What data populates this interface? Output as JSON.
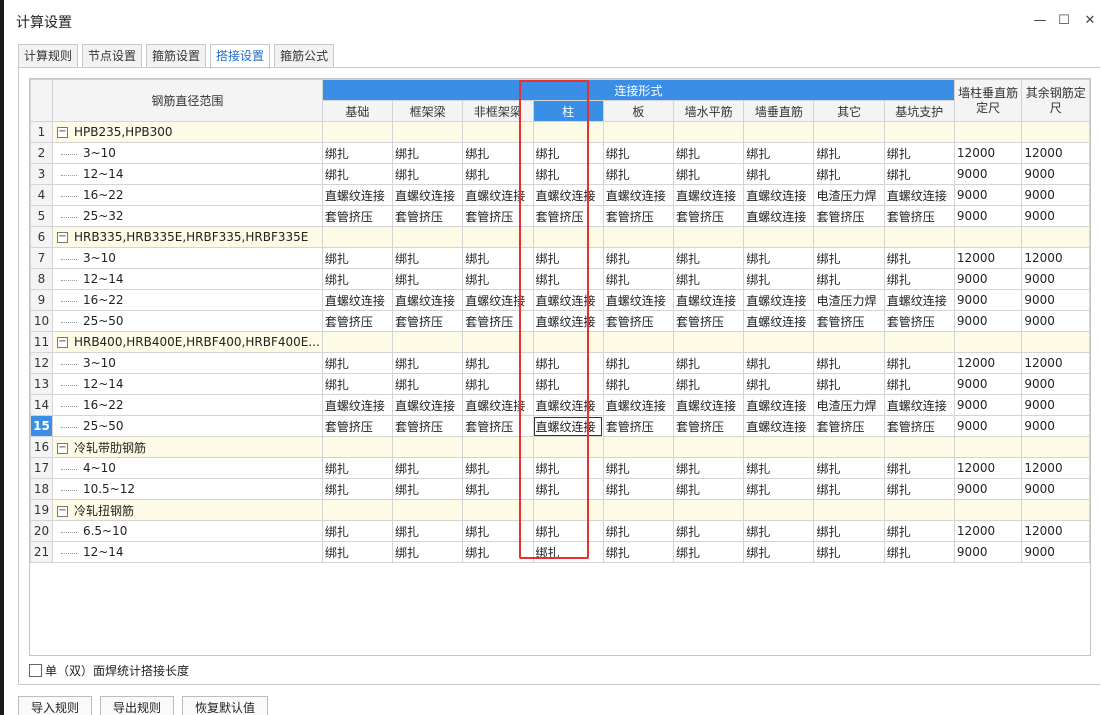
{
  "window": {
    "title": "计算设置",
    "min": "—",
    "max": "☐",
    "close": "✕"
  },
  "tabs": [
    "计算规则",
    "节点设置",
    "箍筋设置",
    "搭接设置",
    "箍筋公式"
  ],
  "table": {
    "range_header": "钢筋直径范围",
    "group_header": "连接形式",
    "sub_headers": [
      "基础",
      "框架梁",
      "非框架梁",
      "柱",
      "板",
      "墙水平筋",
      "墙垂直筋",
      "其它",
      "基坑支护"
    ],
    "col_wall_vertical": [
      "墙柱垂直筋",
      "定尺"
    ],
    "col_other": [
      "其余钢筋定",
      "尺"
    ],
    "groups": [
      {
        "row": "1",
        "name": "HPB235,HPB300",
        "rows": [
          {
            "row": "2",
            "range": "3~10",
            "values": [
              "绑扎",
              "绑扎",
              "绑扎",
              "绑扎",
              "绑扎",
              "绑扎",
              "绑扎",
              "绑扎",
              "绑扎",
              "12000",
              "12000"
            ]
          },
          {
            "row": "3",
            "range": "12~14",
            "values": [
              "绑扎",
              "绑扎",
              "绑扎",
              "绑扎",
              "绑扎",
              "绑扎",
              "绑扎",
              "绑扎",
              "绑扎",
              "9000",
              "9000"
            ]
          },
          {
            "row": "4",
            "range": "16~22",
            "values": [
              "直螺纹连接",
              "直螺纹连接",
              "直螺纹连接",
              "直螺纹连接",
              "直螺纹连接",
              "直螺纹连接",
              "直螺纹连接",
              "电渣压力焊",
              "直螺纹连接",
              "9000",
              "9000"
            ]
          },
          {
            "row": "5",
            "range": "25~32",
            "values": [
              "套管挤压",
              "套管挤压",
              "套管挤压",
              "套管挤压",
              "套管挤压",
              "套管挤压",
              "直螺纹连接",
              "套管挤压",
              "套管挤压",
              "9000",
              "9000"
            ]
          }
        ]
      },
      {
        "row": "6",
        "name": "HRB335,HRB335E,HRBF335,HRBF335E",
        "rows": [
          {
            "row": "7",
            "range": "3~10",
            "values": [
              "绑扎",
              "绑扎",
              "绑扎",
              "绑扎",
              "绑扎",
              "绑扎",
              "绑扎",
              "绑扎",
              "绑扎",
              "12000",
              "12000"
            ]
          },
          {
            "row": "8",
            "range": "12~14",
            "values": [
              "绑扎",
              "绑扎",
              "绑扎",
              "绑扎",
              "绑扎",
              "绑扎",
              "绑扎",
              "绑扎",
              "绑扎",
              "9000",
              "9000"
            ]
          },
          {
            "row": "9",
            "range": "16~22",
            "values": [
              "直螺纹连接",
              "直螺纹连接",
              "直螺纹连接",
              "直螺纹连接",
              "直螺纹连接",
              "直螺纹连接",
              "直螺纹连接",
              "电渣压力焊",
              "直螺纹连接",
              "9000",
              "9000"
            ]
          },
          {
            "row": "10",
            "range": "25~50",
            "values": [
              "套管挤压",
              "套管挤压",
              "套管挤压",
              "直螺纹连接",
              "套管挤压",
              "套管挤压",
              "直螺纹连接",
              "套管挤压",
              "套管挤压",
              "9000",
              "9000"
            ]
          }
        ]
      },
      {
        "row": "11",
        "name": "HRB400,HRB400E,HRBF400,HRBF400E...",
        "rows": [
          {
            "row": "12",
            "range": "3~10",
            "values": [
              "绑扎",
              "绑扎",
              "绑扎",
              "绑扎",
              "绑扎",
              "绑扎",
              "绑扎",
              "绑扎",
              "绑扎",
              "12000",
              "12000"
            ]
          },
          {
            "row": "13",
            "range": "12~14",
            "values": [
              "绑扎",
              "绑扎",
              "绑扎",
              "绑扎",
              "绑扎",
              "绑扎",
              "绑扎",
              "绑扎",
              "绑扎",
              "9000",
              "9000"
            ]
          },
          {
            "row": "14",
            "range": "16~22",
            "values": [
              "直螺纹连接",
              "直螺纹连接",
              "直螺纹连接",
              "直螺纹连接",
              "直螺纹连接",
              "直螺纹连接",
              "直螺纹连接",
              "电渣压力焊",
              "直螺纹连接",
              "9000",
              "9000"
            ]
          },
          {
            "row": "15",
            "range": "25~50",
            "values": [
              "套管挤压",
              "套管挤压",
              "套管挤压",
              "直螺纹连接",
              "套管挤压",
              "套管挤压",
              "直螺纹连接",
              "套管挤压",
              "套管挤压",
              "9000",
              "9000"
            ]
          }
        ]
      },
      {
        "row": "16",
        "name": "冷轧带肋钢筋",
        "rows": [
          {
            "row": "17",
            "range": "4~10",
            "values": [
              "绑扎",
              "绑扎",
              "绑扎",
              "绑扎",
              "绑扎",
              "绑扎",
              "绑扎",
              "绑扎",
              "绑扎",
              "12000",
              "12000"
            ]
          },
          {
            "row": "18",
            "range": "10.5~12",
            "values": [
              "绑扎",
              "绑扎",
              "绑扎",
              "绑扎",
              "绑扎",
              "绑扎",
              "绑扎",
              "绑扎",
              "绑扎",
              "9000",
              "9000"
            ]
          }
        ]
      },
      {
        "row": "19",
        "name": "冷轧扭钢筋",
        "rows": [
          {
            "row": "20",
            "range": "6.5~10",
            "values": [
              "绑扎",
              "绑扎",
              "绑扎",
              "绑扎",
              "绑扎",
              "绑扎",
              "绑扎",
              "绑扎",
              "绑扎",
              "12000",
              "12000"
            ]
          },
          {
            "row": "21",
            "range": "12~14",
            "values": [
              "绑扎",
              "绑扎",
              "绑扎",
              "绑扎",
              "绑扎",
              "绑扎",
              "绑扎",
              "绑扎",
              "绑扎",
              "9000",
              "9000"
            ]
          }
        ]
      }
    ]
  },
  "checkbox_label": "单（双）面焊统计搭接长度",
  "buttons": [
    "导入规则",
    "导出规则",
    "恢复默认值"
  ],
  "selected_row": "15",
  "accent_color": "#3a8ee6",
  "highlight_color": "#e8312f",
  "toggle_symbol": "−"
}
